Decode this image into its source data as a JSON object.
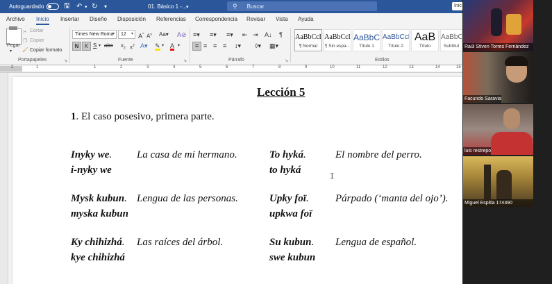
{
  "titlebar": {
    "autosave_label": "Autoguardado",
    "doc_title": "01. Básico 1 -...",
    "search_placeholder": "Buscar",
    "user_button": "Inic"
  },
  "tabs": [
    "Archivo",
    "Inicio",
    "Insertar",
    "Diseño",
    "Disposición",
    "Referencias",
    "Correspondencia",
    "Revisar",
    "Vista",
    "Ayuda"
  ],
  "clipboard": {
    "paste_label": "Pegar",
    "cut_label": "Cortar",
    "copy_label": "Copiar",
    "format_painter_label": "Copiar formato",
    "group_label": "Portapapeles"
  },
  "font": {
    "font_name": "Times New Roma",
    "font_size": "12",
    "group_label": "Fuente"
  },
  "paragraph": {
    "group_label": "Párrafo"
  },
  "styles": {
    "group_label": "Estilos",
    "items": [
      {
        "sample": "AaBbCcI",
        "name": "¶ Normal"
      },
      {
        "sample": "AaBbCcI",
        "name": "¶ Sin espa..."
      },
      {
        "sample": "AaBbC",
        "name": "Título 1"
      },
      {
        "sample": "AaBbCcI",
        "name": "Título 2"
      },
      {
        "sample": "AaB",
        "name": "Título"
      },
      {
        "sample": "AaBbCc",
        "name": "Subtítul"
      }
    ]
  },
  "ruler_numbers": [
    "2",
    "1",
    "1",
    "2",
    "3",
    "4",
    "5",
    "6",
    "7",
    "8",
    "9",
    "10",
    "11",
    "12",
    "13",
    "14",
    "15"
  ],
  "document": {
    "title": "Lección 5",
    "heading_number": "1",
    "heading_text": ". El caso posesivo, primera parte.",
    "entries": [
      {
        "word": "Inyky we",
        "punct": ".",
        "gloss": "La casa de mi hermano.",
        "form": "i-nyky we"
      },
      {
        "word": "To hyká",
        "punct": ".",
        "gloss": "El nombre del perro.",
        "form": "to hyká"
      },
      {
        "word": "Mysk kubun",
        "punct": ".",
        "gloss": "Lengua de las personas.",
        "form": "myska kubun"
      },
      {
        "word": "Upky foï",
        "punct": ".",
        "gloss": "Párpado (‘manta del ojo’).",
        "form": "upkwa foï"
      },
      {
        "word": "Ky chihizhá",
        "punct": ".",
        "gloss": "Las raíces del árbol.",
        "form": "kye chihizhá"
      },
      {
        "word": "Su kubun",
        "punct": ".",
        "gloss": "Lengua de español.",
        "form": "swe kubun"
      }
    ]
  },
  "participants": [
    {
      "name": "Raúl Stiven Torres Fernández"
    },
    {
      "name": "Facundo Saravia"
    },
    {
      "name": "luis restrepo"
    },
    {
      "name": "Miguel Espitia 174390"
    }
  ]
}
